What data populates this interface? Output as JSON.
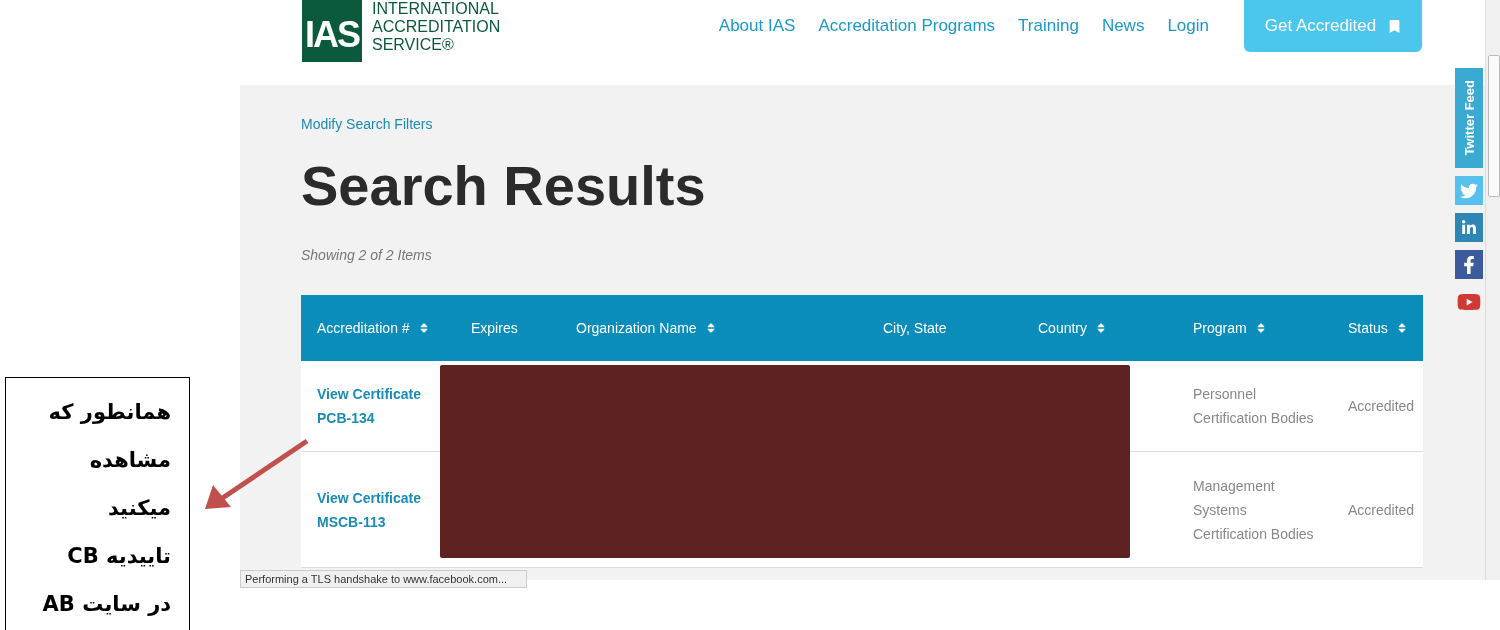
{
  "logo": {
    "mark": "IAS",
    "lines": [
      "INTERNATIONAL",
      "ACCREDITATION",
      "SERVICE®"
    ]
  },
  "nav": [
    {
      "label": "About IAS"
    },
    {
      "label": "Accreditation Programs"
    },
    {
      "label": "Training"
    },
    {
      "label": "News"
    },
    {
      "label": "Login"
    }
  ],
  "cta_button": {
    "label": "Get Accredited"
  },
  "breadcrumb": "Modify Search Filters",
  "title": "Search Results",
  "summary": "Showing 2 of 2 Items",
  "table": {
    "columns": [
      {
        "label": "Accreditation #",
        "sortable": true
      },
      {
        "label": "Expires",
        "sortable": false
      },
      {
        "label": "Organization Name",
        "sortable": true
      },
      {
        "label": "City, State",
        "sortable": false
      },
      {
        "label": "Country",
        "sortable": true
      },
      {
        "label": "Program",
        "sortable": true
      },
      {
        "label": "Status",
        "sortable": true
      }
    ],
    "rows": [
      {
        "link": "View Certificate",
        "id": "PCB-134",
        "program": [
          "Personnel",
          "Certification Bodies"
        ],
        "status": "Accredited"
      },
      {
        "link": "View Certificate",
        "id": "MSCB-113",
        "program": [
          "Management",
          "Systems",
          "Certification Bodies"
        ],
        "status": "Accredited"
      }
    ]
  },
  "social_sidebar": {
    "tab": "Twitter Feed"
  },
  "status_bar": "Performing a TLS handshake to www.facebook.com...",
  "annotation": {
    "lines": [
      "همانطور که",
      "مشاهده",
      "میکنید",
      "تاییدیه CB",
      "در سایت AB"
    ]
  }
}
